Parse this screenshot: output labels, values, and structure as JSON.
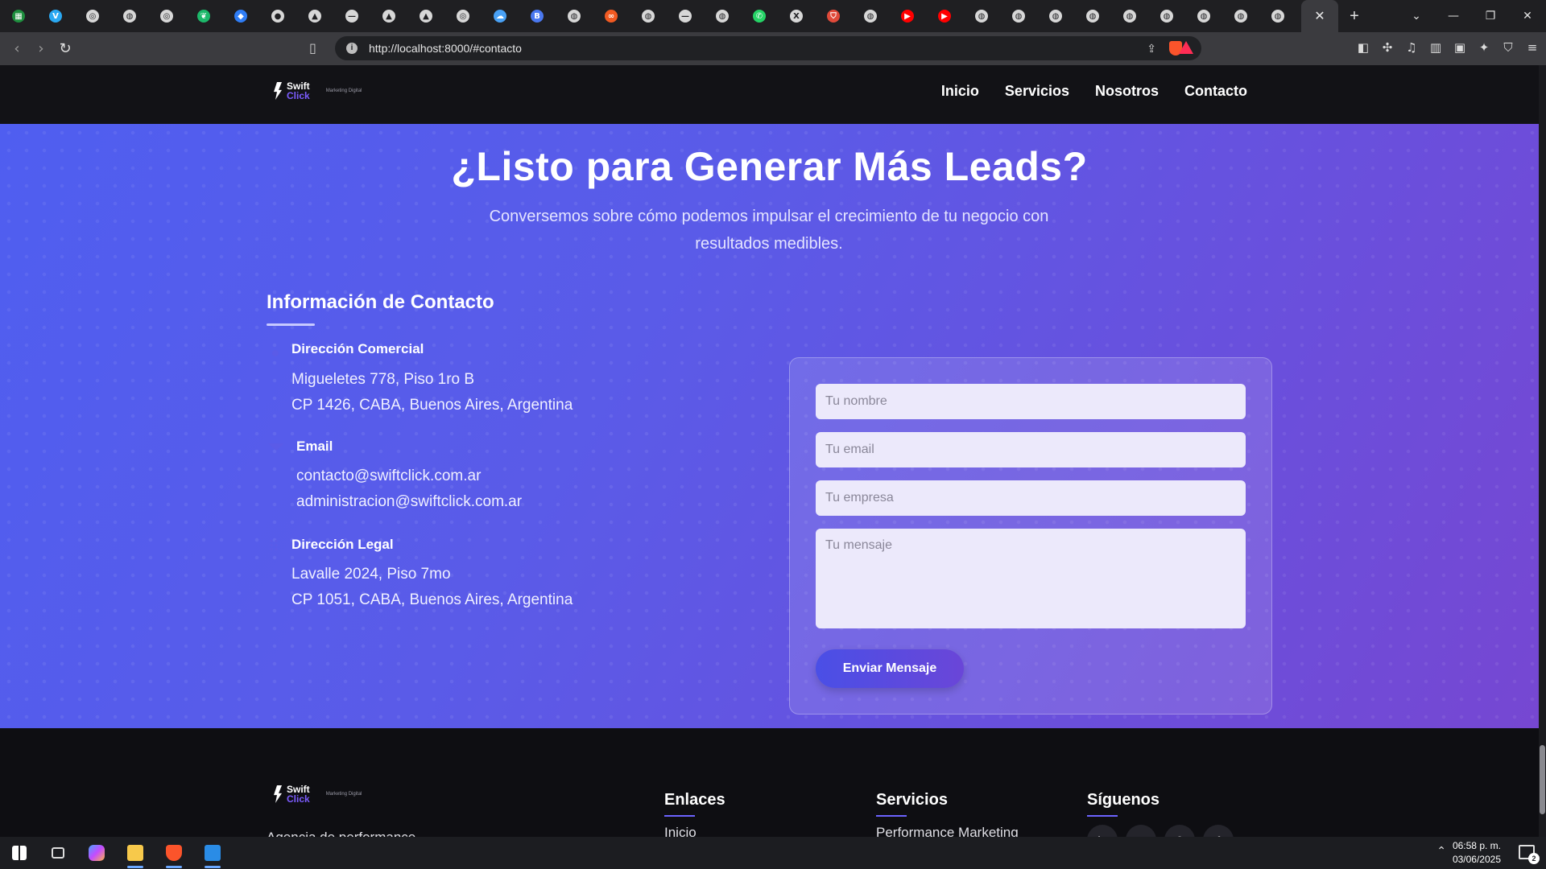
{
  "browser": {
    "url": "http://localhost:8000/#contacto",
    "tab_icons": [
      "sheets-icon",
      "v-icon",
      "ring-icon",
      "globe-icon",
      "ring-icon",
      "leaf-icon",
      "drop-icon",
      "github-icon",
      "triangle-icon",
      "dash-icon",
      "triangle-icon",
      "triangle-icon",
      "ring-icon",
      "cloud-icon",
      "ba-icon",
      "globe-icon",
      "chain-icon",
      "globe-icon",
      "dash-icon",
      "globe-icon",
      "whatsapp-icon",
      "x-icon",
      "shield-icon",
      "globe-icon",
      "youtube-icon",
      "youtube-icon",
      "globe-icon",
      "globe-icon",
      "globe-icon",
      "globe-icon",
      "globe-icon",
      "globe-icon",
      "globe-icon",
      "globe-icon",
      "globe-icon"
    ]
  },
  "site": {
    "logo": {
      "word1": "Swift",
      "word2": "Click",
      "tagline": "Marketing Digital"
    },
    "nav": [
      "Inicio",
      "Servicios",
      "Nosotros",
      "Contacto"
    ]
  },
  "contact": {
    "title": "¿Listo para Generar Más Leads?",
    "subtitle": "Conversemos sobre cómo podemos impulsar el crecimiento de tu negocio con resultados medibles.",
    "info_title": "Información de Contacto",
    "items": [
      {
        "title": "Dirección Comercial",
        "lines": [
          "Migueletes 778, Piso 1ro B",
          "CP 1426, CABA, Buenos Aires, Argentina"
        ]
      },
      {
        "title": "Email",
        "lines": [
          "contacto@swiftclick.com.ar",
          "administracion@swiftclick.com.ar"
        ]
      },
      {
        "title": "Dirección Legal",
        "lines": [
          "Lavalle 2024, Piso 7mo",
          "CP 1051, CABA, Buenos Aires, Argentina"
        ]
      }
    ],
    "form": {
      "name_placeholder": "Tu nombre",
      "email_placeholder": "Tu email",
      "company_placeholder": "Tu empresa",
      "message_placeholder": "Tu mensaje",
      "submit": "Enviar Mensaje"
    }
  },
  "footer": {
    "agency_text": "Agencia de performance",
    "links_title": "Enlaces",
    "links_first": "Inicio",
    "services_title": "Servicios",
    "services_first": "Performance Marketing",
    "social_title": "Síguenos",
    "social": [
      "linkedin-icon",
      "twitter-icon",
      "instagram-icon",
      "facebook-icon"
    ]
  },
  "taskbar": {
    "time": "06:58 p. m.",
    "date": "03/06/2025",
    "notifications": "2"
  },
  "colors": {
    "hero_start": "#4f5ef0",
    "hero_end": "#7647d2",
    "accent": "#6c63ff",
    "nav_bg": "#121216"
  }
}
